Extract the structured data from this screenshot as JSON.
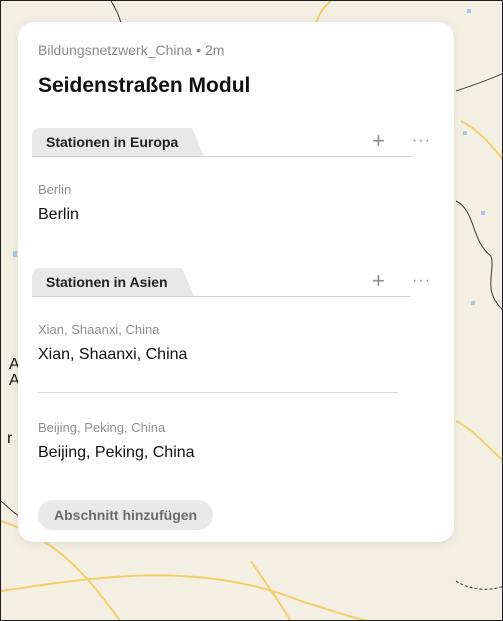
{
  "list": {
    "author": "Bildungsnetzwerk_China",
    "separator": "•",
    "age": "2m",
    "title": "Seidenstraßen Modul"
  },
  "sections": [
    {
      "name": "Stationen in Europa",
      "add_icon": "plus-icon",
      "more_icon": "more-icon",
      "entries": [
        {
          "subtitle": "Berlin",
          "name": "Berlin"
        }
      ]
    },
    {
      "name": "Stationen in Asien",
      "add_icon": "plus-icon",
      "more_icon": "more-icon",
      "entries": [
        {
          "subtitle": "Xian, Shaanxi, China",
          "name": "Xian, Shaanxi, China"
        },
        {
          "subtitle": "Beijing, Peking, China",
          "name": "Beijing, Peking, China"
        }
      ]
    }
  ],
  "glyphs": {
    "plus": "+",
    "more": "···"
  },
  "add_section_label": "Abschnitt hinzufügen",
  "map": {
    "labels": [
      "A",
      "A",
      "r"
    ],
    "colors": {
      "land": "#f3efe2",
      "roads": "#f2cf6a",
      "borders": "#3a3a3a",
      "water": "#a9c7e6"
    }
  }
}
